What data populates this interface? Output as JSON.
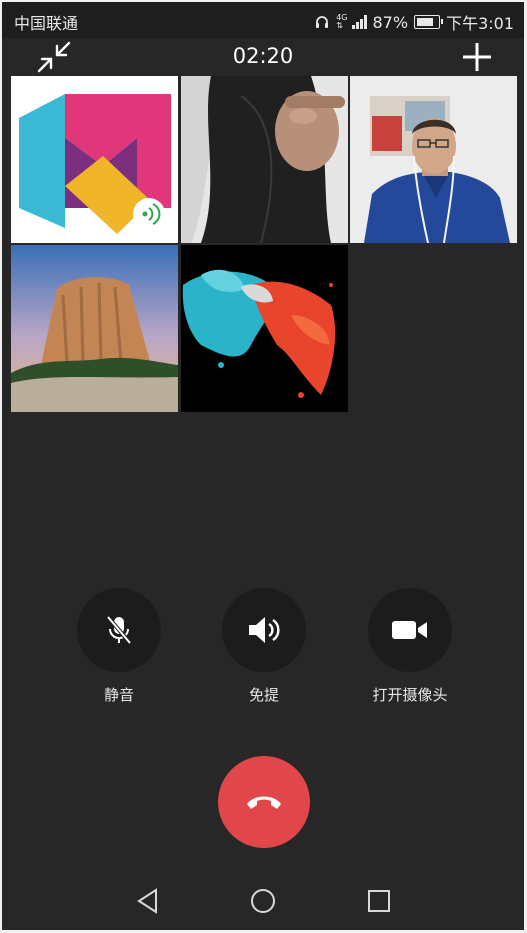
{
  "status_bar": {
    "carrier": "中国联通",
    "network_top": "4G",
    "network_bottom": "⇅",
    "battery": "87%",
    "battery_level": 0.87,
    "time": "下午3:01"
  },
  "call": {
    "duration": "02:20"
  },
  "controls": {
    "mute_label": "静音",
    "speaker_label": "免提",
    "camera_label": "打开摄像头"
  },
  "icons": {
    "shrink": "shrink-arrows-icon",
    "add": "plus-icon",
    "mute": "mic-off-icon",
    "speaker": "speaker-icon",
    "camera": "video-camera-icon",
    "hangup": "phone-hangup-icon",
    "back": "back-triangle-icon",
    "home": "home-circle-icon",
    "recents": "recents-square-icon"
  },
  "colors": {
    "background": "#272727",
    "hangup": "#e0464a",
    "control_circle": "#1c1c1c"
  }
}
